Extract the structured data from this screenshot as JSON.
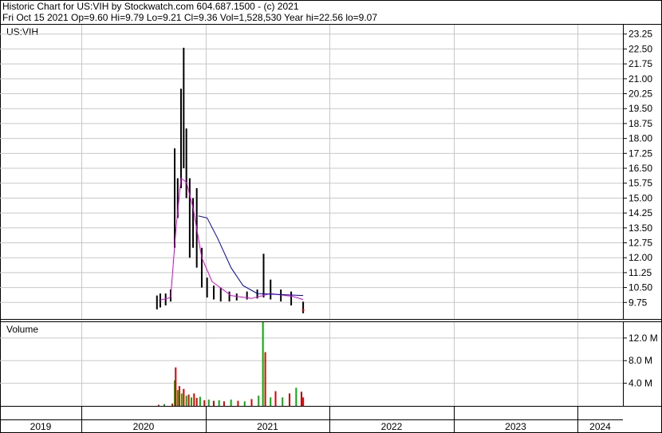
{
  "header": {
    "title_line": "Historic Chart for US:VIH by Stockwatch.com 604.687.1500 - (c) 2021",
    "stats_line": "Fri Oct 15 2021  Op=9.60  Hi=9.79  Lo=9.21  Cl=9.36  Vol=1,528,530  Year hi=22.56  lo=9.07"
  },
  "panels": {
    "price_label": "US:VIH",
    "volume_label": "Volume"
  },
  "colors": {
    "background": "#ffffff",
    "grid": "#c8c8c8",
    "price_bars": "#000000",
    "up_volume": "#00b000",
    "down_volume": "#e00000",
    "ma_short": "#e000e0",
    "ma_long": "#0000c0",
    "close_dot": "#d00000"
  },
  "chart_data": [
    {
      "type": "line",
      "title": "US:VIH",
      "x_axis_labels": [
        "2019",
        "2020",
        "2021",
        "2022",
        "2023",
        "2024"
      ],
      "yticks": [
        "23.25",
        "22.50",
        "21.75",
        "21.00",
        "20.25",
        "19.50",
        "18.75",
        "18.00",
        "17.25",
        "16.50",
        "15.75",
        "15.00",
        "14.25",
        "13.50",
        "12.75",
        "12.00",
        "11.25",
        "10.50",
        "9.75"
      ],
      "ylim": [
        9.0,
        23.6
      ],
      "x_range": [
        "2019-01-01",
        "2024-12-31"
      ],
      "grid": true,
      "series": [
        {
          "kind": "ohlc_highlow",
          "points": [
            {
              "x": "2020-08-10",
              "lo": 9.4,
              "hi": 10.1
            },
            {
              "x": "2020-08-20",
              "lo": 9.5,
              "hi": 10.2
            },
            {
              "x": "2020-09-05",
              "lo": 9.6,
              "hi": 10.2
            },
            {
              "x": "2020-09-20",
              "lo": 9.8,
              "hi": 10.4
            },
            {
              "x": "2020-10-01",
              "lo": 12.5,
              "hi": 17.5
            },
            {
              "x": "2020-10-10",
              "lo": 14.0,
              "hi": 16.0
            },
            {
              "x": "2020-10-20",
              "lo": 15.5,
              "hi": 20.5
            },
            {
              "x": "2020-10-28",
              "lo": 16.5,
              "hi": 22.56
            },
            {
              "x": "2020-11-05",
              "lo": 15.0,
              "hi": 18.5
            },
            {
              "x": "2020-11-15",
              "lo": 12.0,
              "hi": 16.0
            },
            {
              "x": "2020-11-25",
              "lo": 12.5,
              "hi": 15.0
            },
            {
              "x": "2020-12-05",
              "lo": 11.5,
              "hi": 15.5
            },
            {
              "x": "2020-12-20",
              "lo": 10.5,
              "hi": 12.5
            },
            {
              "x": "2021-01-05",
              "lo": 10.0,
              "hi": 11.0
            },
            {
              "x": "2021-01-25",
              "lo": 9.9,
              "hi": 10.6
            },
            {
              "x": "2021-02-15",
              "lo": 9.8,
              "hi": 10.5
            },
            {
              "x": "2021-03-10",
              "lo": 9.8,
              "hi": 10.3
            },
            {
              "x": "2021-04-01",
              "lo": 9.85,
              "hi": 10.2
            },
            {
              "x": "2021-05-01",
              "lo": 9.9,
              "hi": 10.3
            },
            {
              "x": "2021-06-01",
              "lo": 9.95,
              "hi": 10.4
            },
            {
              "x": "2021-06-20",
              "lo": 10.0,
              "hi": 12.2
            },
            {
              "x": "2021-07-10",
              "lo": 9.9,
              "hi": 10.9
            },
            {
              "x": "2021-08-10",
              "lo": 9.8,
              "hi": 10.4
            },
            {
              "x": "2021-09-10",
              "lo": 9.6,
              "hi": 10.3
            },
            {
              "x": "2021-10-15",
              "lo": 9.21,
              "hi": 9.79
            }
          ]
        },
        {
          "name": "",
          "kind": "moving_average_short",
          "color": "#e000e0",
          "points": [
            {
              "x": "2020-08-15",
              "y": 9.85
            },
            {
              "x": "2020-09-20",
              "y": 10.0
            },
            {
              "x": "2020-10-05",
              "y": 13.5
            },
            {
              "x": "2020-10-20",
              "y": 16.0
            },
            {
              "x": "2020-11-05",
              "y": 15.8
            },
            {
              "x": "2020-11-25",
              "y": 14.5
            },
            {
              "x": "2020-12-20",
              "y": 12.0
            },
            {
              "x": "2021-01-20",
              "y": 10.8
            },
            {
              "x": "2021-03-15",
              "y": 10.1
            },
            {
              "x": "2021-05-15",
              "y": 9.95
            },
            {
              "x": "2021-07-10",
              "y": 10.2
            },
            {
              "x": "2021-09-15",
              "y": 10.05
            },
            {
              "x": "2021-10-15",
              "y": 9.9
            }
          ]
        },
        {
          "name": "",
          "kind": "moving_average_long",
          "color": "#0000c0",
          "points": [
            {
              "x": "2020-12-10",
              "y": 14.1
            },
            {
              "x": "2021-01-05",
              "y": 14.0
            },
            {
              "x": "2021-02-05",
              "y": 13.0
            },
            {
              "x": "2021-03-15",
              "y": 11.5
            },
            {
              "x": "2021-04-20",
              "y": 10.6
            },
            {
              "x": "2021-06-01",
              "y": 10.2
            },
            {
              "x": "2021-08-01",
              "y": 10.15
            },
            {
              "x": "2021-10-15",
              "y": 10.1
            }
          ]
        }
      ]
    },
    {
      "type": "bar",
      "title": "Volume",
      "yticks": [
        "12.0 M",
        "8.0 M",
        "4.0 M"
      ],
      "ylim": [
        0,
        14.8
      ],
      "y_unit": "M",
      "grid": true,
      "bars": [
        {
          "x": "2020-08-15",
          "v": 0.2,
          "up": false
        },
        {
          "x": "2020-09-01",
          "v": 0.3,
          "up": true
        },
        {
          "x": "2020-09-25",
          "v": 0.4,
          "up": false
        },
        {
          "x": "2020-10-01",
          "v": 4.5,
          "up": true
        },
        {
          "x": "2020-10-04",
          "v": 6.8,
          "up": false
        },
        {
          "x": "2020-10-10",
          "v": 2.8,
          "up": true
        },
        {
          "x": "2020-10-15",
          "v": 3.5,
          "up": false
        },
        {
          "x": "2020-10-22",
          "v": 2.2,
          "up": true
        },
        {
          "x": "2020-10-28",
          "v": 3.0,
          "up": false
        },
        {
          "x": "2020-11-05",
          "v": 1.8,
          "up": true
        },
        {
          "x": "2020-11-12",
          "v": 2.0,
          "up": false
        },
        {
          "x": "2020-11-20",
          "v": 1.5,
          "up": true
        },
        {
          "x": "2020-11-28",
          "v": 2.2,
          "up": false
        },
        {
          "x": "2020-12-05",
          "v": 1.4,
          "up": false
        },
        {
          "x": "2020-12-15",
          "v": 1.6,
          "up": true
        },
        {
          "x": "2020-12-28",
          "v": 1.0,
          "up": false
        },
        {
          "x": "2021-01-10",
          "v": 1.1,
          "up": true
        },
        {
          "x": "2021-01-25",
          "v": 0.9,
          "up": false
        },
        {
          "x": "2021-02-10",
          "v": 1.0,
          "up": true
        },
        {
          "x": "2021-02-25",
          "v": 0.8,
          "up": false
        },
        {
          "x": "2021-03-15",
          "v": 1.1,
          "up": true
        },
        {
          "x": "2021-04-05",
          "v": 0.9,
          "up": false
        },
        {
          "x": "2021-04-25",
          "v": 0.8,
          "up": true
        },
        {
          "x": "2021-05-15",
          "v": 1.2,
          "up": false
        },
        {
          "x": "2021-06-05",
          "v": 1.8,
          "up": true
        },
        {
          "x": "2021-06-18",
          "v": 14.8,
          "up": true
        },
        {
          "x": "2021-06-25",
          "v": 9.5,
          "up": false
        },
        {
          "x": "2021-07-10",
          "v": 1.5,
          "up": true
        },
        {
          "x": "2021-07-25",
          "v": 2.6,
          "up": false
        },
        {
          "x": "2021-08-15",
          "v": 1.5,
          "up": true
        },
        {
          "x": "2021-09-05",
          "v": 2.2,
          "up": false
        },
        {
          "x": "2021-09-25",
          "v": 3.2,
          "up": true
        },
        {
          "x": "2021-10-10",
          "v": 2.5,
          "up": false
        },
        {
          "x": "2021-10-15",
          "v": 1.5,
          "up": false
        }
      ]
    }
  ]
}
